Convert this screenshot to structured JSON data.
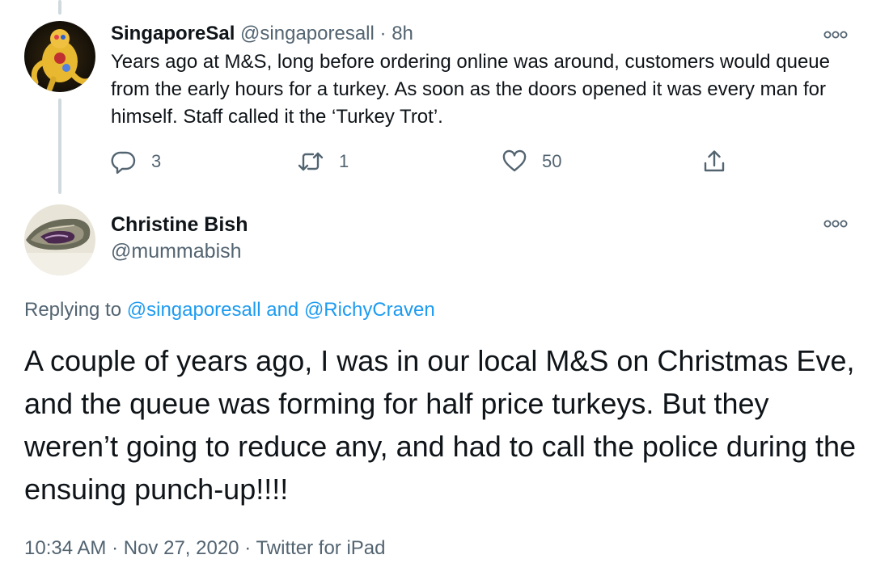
{
  "reply_tweet": {
    "display_name": "SingaporeSal",
    "handle": "@singaporesall",
    "separator": "·",
    "time": "8h",
    "text": "Years ago at M&S, long before ordering online was around, customers would queue from the early hours for a turkey. As soon as the doors opened it was every man for himself. Staff called it the ‘Turkey Trot’.",
    "reply_count": "3",
    "retweet_count": "1",
    "like_count": "50"
  },
  "main_tweet": {
    "display_name": "Christine Bish",
    "handle": "@mummabish",
    "replying_prefix": "Replying to",
    "replying_user_1": "@singaporesall",
    "replying_and": "and",
    "replying_user_2": "@RichyCraven",
    "text": "A couple of years ago, I was in our local M&S on Christmas Eve, and the queue was forming for half price turkeys. But they weren’t going to reduce any, and had to call the police during the ensuing punch-up!!!!",
    "time": "10:34 AM",
    "date": "Nov 27, 2020",
    "source": "Twitter for iPad",
    "separator": "·"
  },
  "colors": {
    "text_primary": "#0f1419",
    "text_secondary": "#536471",
    "link": "#1d9bf0",
    "thread_line": "#cfd9de"
  },
  "icons": [
    "more-icon",
    "reply-icon",
    "retweet-icon",
    "like-icon",
    "share-icon"
  ]
}
